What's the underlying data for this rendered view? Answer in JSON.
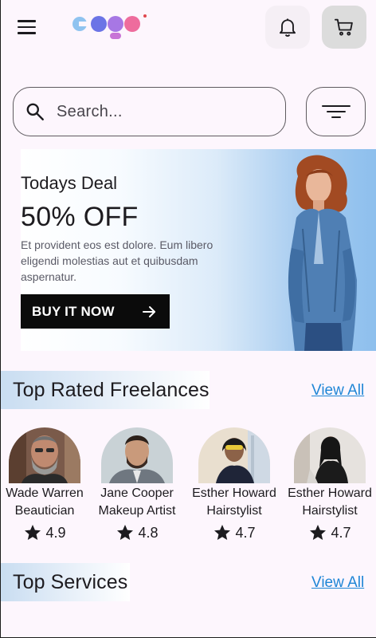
{
  "header": {
    "logo_text": "Logo",
    "menu_icon": "hamburger-menu-icon",
    "notification_icon": "bell-icon",
    "cart_icon": "shopping-cart-icon"
  },
  "search": {
    "placeholder": "Search...",
    "search_icon": "search-icon",
    "filter_icon": "filter-icon"
  },
  "banner": {
    "title": "Todays Deal",
    "headline": "50% OFF",
    "description": "Et provident eos est dolore. Eum libero eligendi molestias aut et quibusdam aspernatur.",
    "button_label": "BUY IT NOW",
    "button_icon": "arrow-right-icon"
  },
  "top_rated": {
    "title": "Top Rated Freelances",
    "view_all": "View All",
    "items": [
      {
        "name": "Wade Warren",
        "role": "Beautician",
        "rating": "4.9"
      },
      {
        "name": "Jane Cooper",
        "role": "Makeup Artist",
        "rating": "4.8"
      },
      {
        "name": "Esther Howard",
        "role": "Hairstylist",
        "rating": "4.7"
      },
      {
        "name": "Esther Howard",
        "role": "Hairstylist",
        "rating": "4.7"
      }
    ]
  },
  "top_services": {
    "title": "Top Services",
    "view_all": "View All"
  },
  "colors": {
    "background": "#fdf6fd",
    "link": "#1f86d6",
    "button": "#0b0b0b",
    "banner_gradient_end": "#8dbfed"
  }
}
